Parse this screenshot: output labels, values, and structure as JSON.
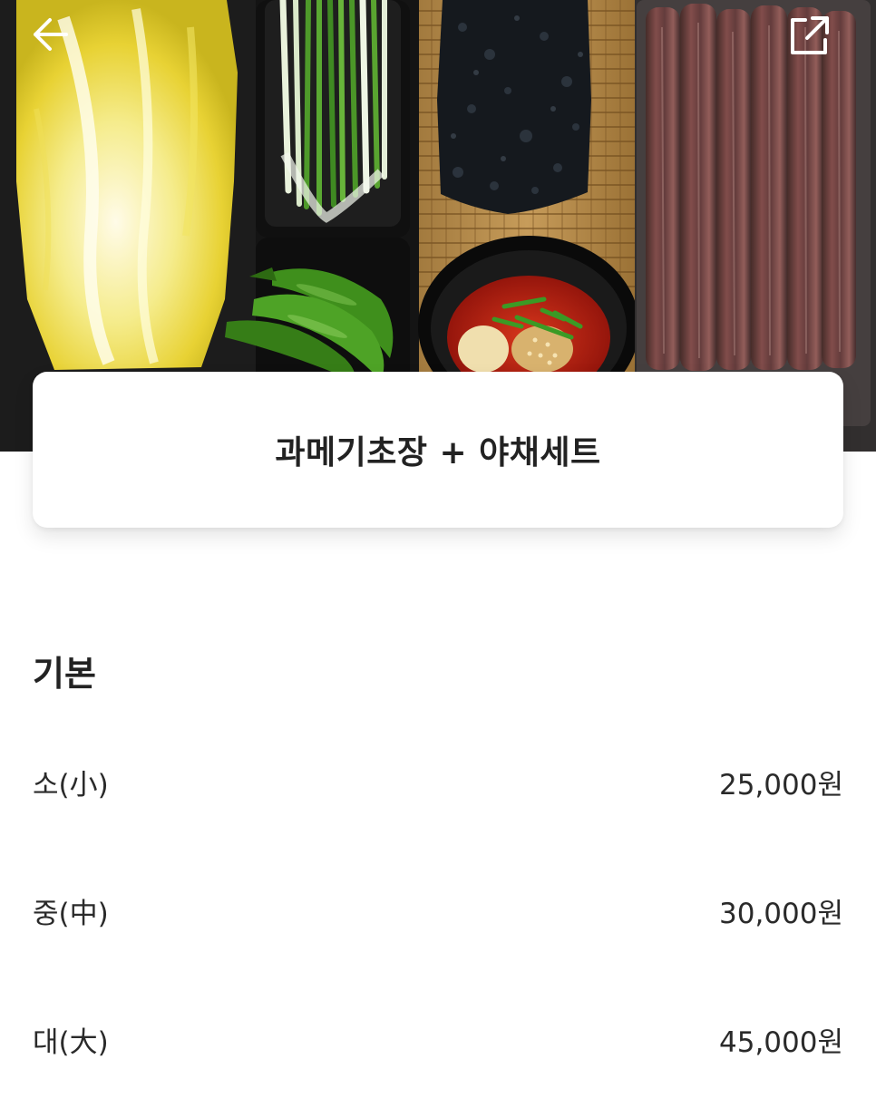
{
  "header": {
    "back_icon": "arrow-left-icon",
    "share_icon": "share-icon"
  },
  "product": {
    "title": "과메기초장 + 야채세트",
    "photo_subject": "napa-cabbage-scallions-seaweed-chili-sauce-gwamegi"
  },
  "price_section": {
    "title": "기본",
    "options": [
      {
        "label": "소(小)",
        "price": "25,000원"
      },
      {
        "label": "중(中)",
        "price": "30,000원"
      },
      {
        "label": "대(大)",
        "price": "45,000원"
      }
    ]
  },
  "colors": {
    "text": "#222222",
    "card_bg": "#ffffff",
    "hero_bg": "#141414"
  }
}
